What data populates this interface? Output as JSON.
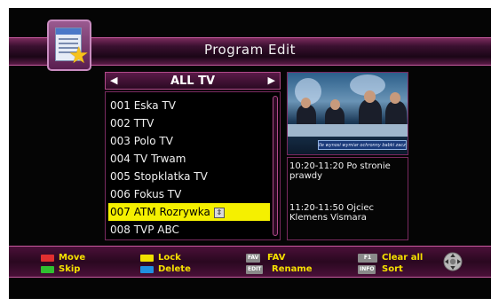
{
  "title": "Program Edit",
  "list_header": {
    "title": "ALL TV",
    "left_arrow": "◀",
    "right_arrow": "▶"
  },
  "channels": [
    {
      "label": "001 Eska TV"
    },
    {
      "label": "002 TTV"
    },
    {
      "label": "003 Polo TV"
    },
    {
      "label": "004 TV Trwam"
    },
    {
      "label": "005 Stopklatka TV"
    },
    {
      "label": "006 Fokus TV"
    },
    {
      "label": "007 ATM Rozrywka",
      "selected": true
    },
    {
      "label": "008 TVP ABC"
    }
  ],
  "preview": {
    "caption": "Ile wynosi wymiar ochronny babki zacz...?"
  },
  "epg": [
    {
      "text": "10:20-11:20  Po stronie\nprawdy"
    },
    {
      "text": "11:20-11:50  Ojciec\nKlemens Vismara"
    }
  ],
  "help": [
    {
      "label": "Move",
      "color": "#e03030"
    },
    {
      "label": "Skip",
      "color": "#30c030"
    },
    {
      "label": "Lock",
      "color": "#f0e000"
    },
    {
      "label": "Delete",
      "color": "#2090e0"
    },
    {
      "key": "FAV",
      "label": "FAV"
    },
    {
      "key": "EDIT",
      "label": "Rename"
    },
    {
      "key": "F1",
      "label": "Clear all"
    },
    {
      "key": "INFO",
      "label": "Sort"
    }
  ],
  "icons": {
    "app": "program-edit-icon",
    "navigate": "navigation-pad-icon",
    "sort_indicator": "move-updown-icon"
  }
}
